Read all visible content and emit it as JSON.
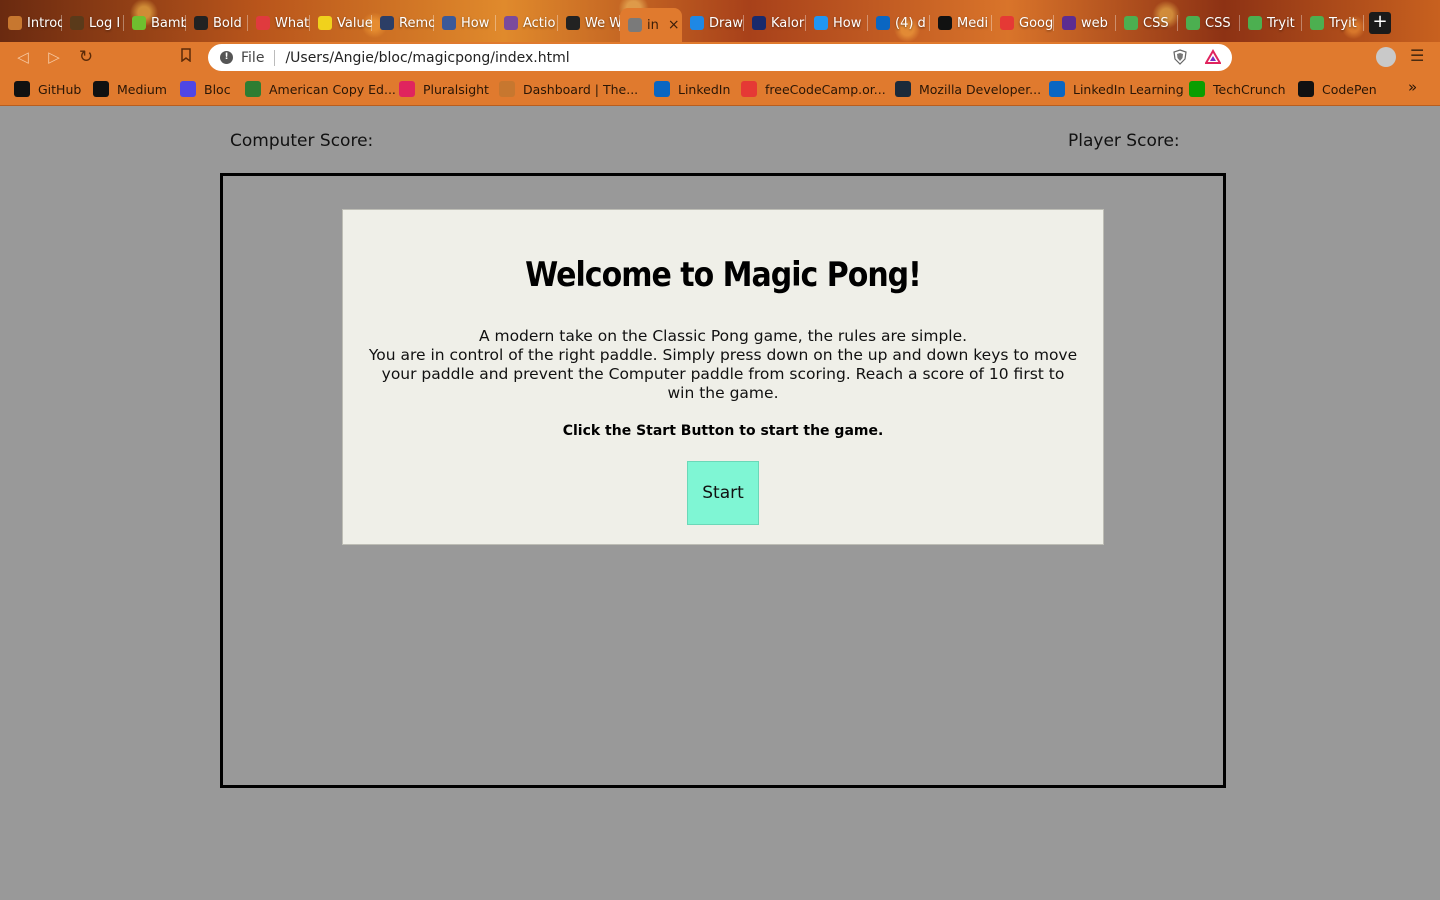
{
  "browser": {
    "tabs": [
      {
        "label": "Introd",
        "icon": "fox-icon",
        "color": "#c7772f"
      },
      {
        "label": "Log I",
        "icon": "peace-hand-icon",
        "color": "#5a3a1a"
      },
      {
        "label": "Bamb",
        "icon": "bamboo-icon",
        "color": "#6fbf2f"
      },
      {
        "label": "Bold",
        "icon": "www-icon",
        "color": "#222222"
      },
      {
        "label": "What",
        "icon": "play-circle-icon",
        "color": "#e03a3e"
      },
      {
        "label": "Value",
        "icon": "js-icon",
        "color": "#f0d21c"
      },
      {
        "label": "Remo",
        "icon": "r-icon",
        "color": "#2c3e66"
      },
      {
        "label": "How",
        "icon": "dc-icon",
        "color": "#3b5998"
      },
      {
        "label": "Actio",
        "icon": "knot-icon",
        "color": "#7b4a9c"
      },
      {
        "label": "We W",
        "icon": "www-icon",
        "color": "#222222"
      },
      {
        "label": "in",
        "icon": "globe-icon",
        "color": "#7a7a7a"
      },
      {
        "label": "Draw",
        "icon": "draw-icon",
        "color": "#1e88e5"
      },
      {
        "label": "Kalor",
        "icon": "kalor-icon",
        "color": "#1a2a6c"
      },
      {
        "label": "How",
        "icon": "f-icon",
        "color": "#2196f3"
      },
      {
        "label": "(4) d",
        "icon": "linkedin-icon",
        "color": "#0a66c2"
      },
      {
        "label": "Medi",
        "icon": "medium-icon",
        "color": "#111111"
      },
      {
        "label": "Goog",
        "icon": "f-circle-icon",
        "color": "#e53935"
      },
      {
        "label": "web",
        "icon": "q-icon",
        "color": "#5c2d91"
      },
      {
        "label": "CSS",
        "icon": "w3-icon",
        "color": "#4caf50"
      },
      {
        "label": "CSS",
        "icon": "w3-icon",
        "color": "#4caf50"
      },
      {
        "label": "Tryit",
        "icon": "w3-icon",
        "color": "#4caf50"
      },
      {
        "label": "Tryit",
        "icon": "w3-icon",
        "color": "#4caf50"
      }
    ],
    "active_tab_index": 10,
    "new_tab_label": "+",
    "address": {
      "scheme": "File",
      "url": "/Users/Angie/bloc/magicpong/index.html"
    },
    "bookmarks": [
      {
        "label": "GitHub",
        "icon": "github-icon",
        "color": "#111111"
      },
      {
        "label": "Medium",
        "icon": "medium-icon",
        "color": "#111111"
      },
      {
        "label": "Bloc",
        "icon": "bloc-icon",
        "color": "#4f46e5"
      },
      {
        "label": "American Copy Ed...",
        "icon": "ace-icon",
        "color": "#2e7d32"
      },
      {
        "label": "Pluralsight",
        "icon": "pluralsight-icon",
        "color": "#e0245e"
      },
      {
        "label": "Dashboard | The...",
        "icon": "fox-icon",
        "color": "#c7772f"
      },
      {
        "label": "LinkedIn",
        "icon": "linkedin-icon",
        "color": "#0a66c2"
      },
      {
        "label": "freeCodeCamp.or...",
        "icon": "youtube-icon",
        "color": "#e53935"
      },
      {
        "label": "Mozilla Developer...",
        "icon": "mdn-icon",
        "color": "#1b2a3a"
      },
      {
        "label": "LinkedIn Learning",
        "icon": "linkedin-learning-icon",
        "color": "#0a66c2"
      },
      {
        "label": "TechCrunch",
        "icon": "techcrunch-icon",
        "color": "#0a9e01"
      },
      {
        "label": "CodePen",
        "icon": "codepen-icon",
        "color": "#111111"
      }
    ],
    "bookmarks_overflow_label": "»"
  },
  "game": {
    "computer_score_label": "Computer Score:",
    "player_score_label": "Player Score:",
    "modal": {
      "title": "Welcome to Magic Pong!",
      "description_lines": [
        "A modern take on the Classic Pong game, the rules are simple.",
        "You are in control of the right paddle. Simply press down on the up and down keys to move your paddle and prevent the Computer paddle from scoring. Reach a score of 10 first to win the game."
      ],
      "cta": "Click the Start Button to start the game.",
      "start_label": "Start"
    }
  },
  "colors": {
    "page_background": "#999999",
    "modal_background": "#efefe8",
    "start_button": "#7ff6d4",
    "browser_chrome": "#e07a2e"
  }
}
